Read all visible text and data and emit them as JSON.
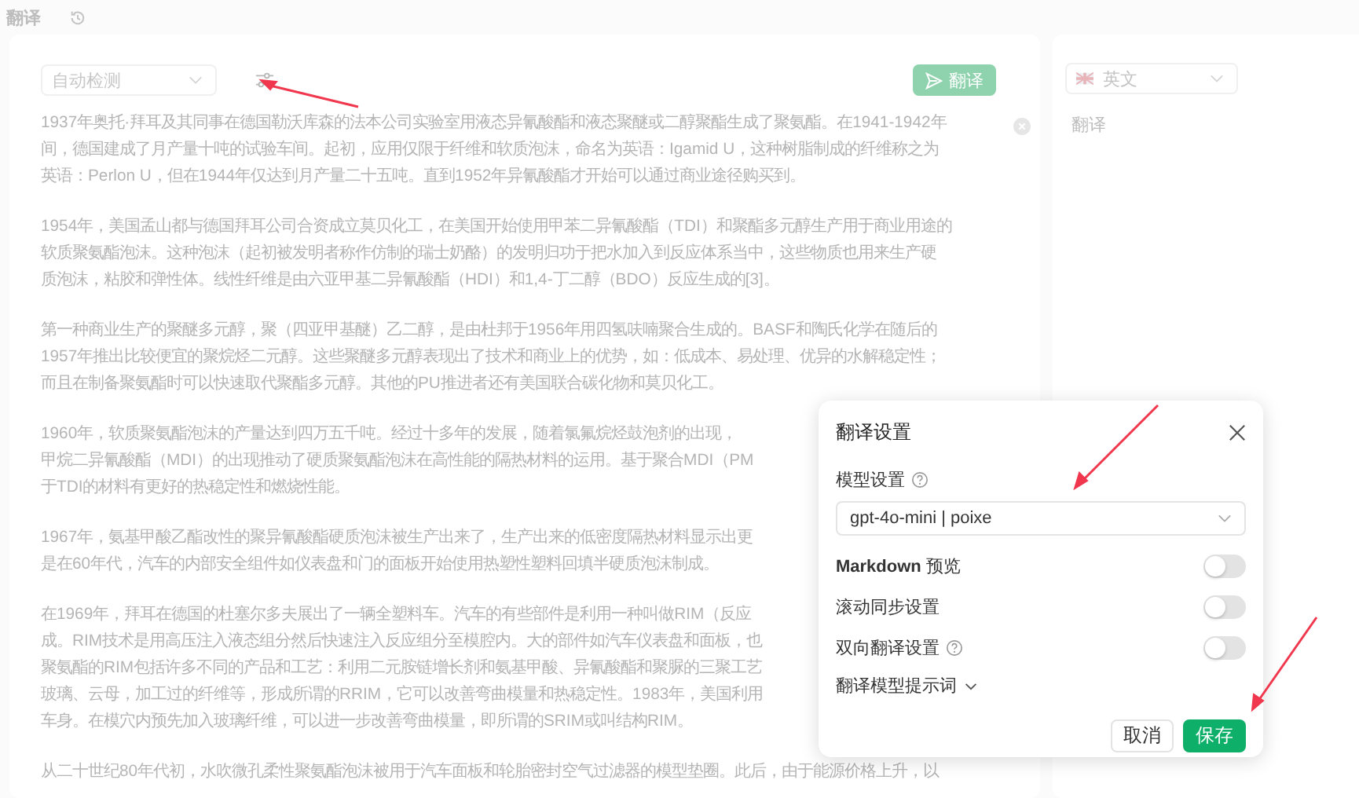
{
  "app": {
    "title": "翻译"
  },
  "source": {
    "language": "自动检测",
    "translate_button": "翻译",
    "translate_disabled": true,
    "paragraphs": [
      {
        "lines": [
          "1937年奥托·拜耳及其同事在德国勒沃库森的法本公司实验室用液态异氰酸酯和液态聚醚或二醇聚酯生成了聚氨酯。在1941-1942年",
          "间，德国建成了月产量十吨的试验车间。起初，应用仅限于纤维和软质泡沫，命名为英语：Igamid U，这种树脂制成的纤维称之为",
          "英语：Perlon U，但在1944年仅达到月产量二十五吨。直到1952年异氰酸酯才开始可以通过商业途径购买到。"
        ]
      },
      {
        "lines": [
          "1954年，美国孟山都与德国拜耳公司合资成立莫贝化工，在美国开始使用甲苯二异氰酸酯（TDI）和聚酯多元醇生产用于商业用途的",
          "软质聚氨酯泡沫。这种泡沫（起初被发明者称作仿制的瑞士奶酪）的发明归功于把水加入到反应体系当中，这些物质也用来生产硬",
          "质泡沫，粘胶和弹性体。线性纤维是由六亚甲基二异氰酸酯（HDI）和1,4-丁二醇（BDO）反应生成的[3]。"
        ]
      },
      {
        "lines": [
          "第一种商业生产的聚醚多元醇，聚（四亚甲基醚）乙二醇，是由杜邦于1956年用四氢呋喃聚合生成的。BASF和陶氏化学在随后的",
          "1957年推出比较便宜的聚烷烃二元醇。这些聚醚多元醇表现出了技术和商业上的优势，如：低成本、易处理、优异的水解稳定性；",
          "而且在制备聚氨酯时可以快速取代聚酯多元醇。其他的PU推进者还有美国联合碳化物和莫贝化工。"
        ]
      },
      {
        "lines": [
          "1960年，软质聚氨酯泡沫的产量达到四万五千吨。经过十多年的发展，随着氯氟烷烃鼓泡剂的出现，",
          "甲烷二异氰酸酯（MDI）的出现推动了硬质聚氨酯泡沫在高性能的隔热材料的运用。基于聚合MDI（PM",
          "于TDI的材料有更好的热稳定性和燃烧性能。"
        ]
      },
      {
        "lines": [
          "1967年，氨基甲酸乙酯改性的聚异氰酸酯硬质泡沫被生产出来了，生产出来的低密度隔热材料显示出更",
          "是在60年代，汽车的内部安全组件如仪表盘和门的面板开始使用热塑性塑料回填半硬质泡沫制成。"
        ]
      },
      {
        "lines": [
          "在1969年，拜耳在德国的杜塞尔多夫展出了一辆全塑料车。汽车的有些部件是利用一种叫做RIM（反应",
          "成。RIM技术是用高压注入液态组分然后快速注入反应组分至模腔内。大的部件如汽车仪表盘和面板，也",
          "聚氨酯的RIM包括许多不同的产品和工艺：利用二元胺链增长剂和氨基甲酸、异氰酸酯和聚脲的三聚工艺",
          "玻璃、云母，加工过的纤维等，形成所谓的RRIM，它可以改善弯曲模量和热稳定性。1983年，美国利用",
          "车身。在模穴内预先加入玻璃纤维，可以进一步改善弯曲模量，即所谓的SRIM或叫结构RIM。"
        ]
      },
      {
        "lines": [
          "从二十世纪80年代初，水吹微孔柔性聚氨酯泡沫被用于汽车面板和轮胎密封空气过滤器的模型垫圈。此后，由于能源价格上升，以"
        ]
      }
    ]
  },
  "target": {
    "language": "英文",
    "placeholder": "翻译"
  },
  "dialog": {
    "title": "翻译设置",
    "model_label": "模型设置",
    "model": "gpt-4o-mini | poixe",
    "settings": [
      {
        "label": "**Markdown** 预览",
        "on": false,
        "help": false
      },
      {
        "label": "滚动同步设置",
        "on": false,
        "help": false
      },
      {
        "label": "双向翻译设置",
        "on": false,
        "help": true
      }
    ],
    "prompt_section": {
      "label": "翻译模型提示词",
      "expanded": false
    },
    "buttons": [
      {
        "label": "取消",
        "kind": "secondary"
      },
      {
        "label": "保存",
        "kind": "primary"
      }
    ]
  }
}
